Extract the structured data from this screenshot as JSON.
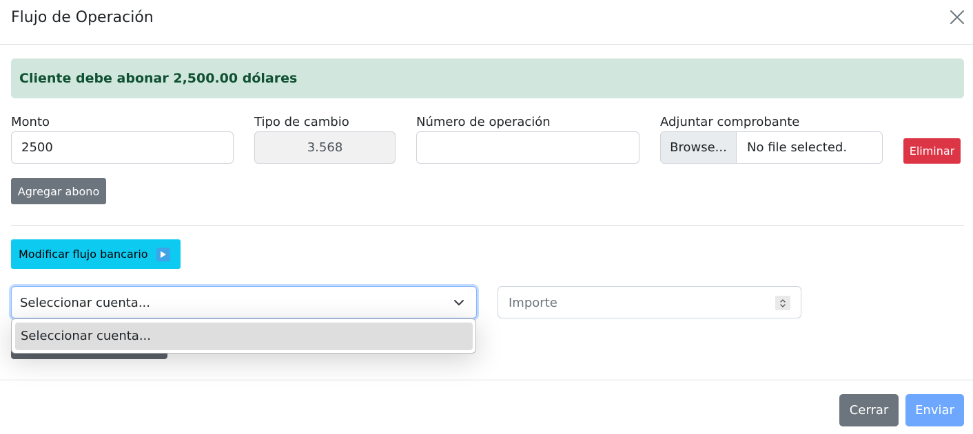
{
  "modal": {
    "title": "Flujo de Operación"
  },
  "alert": {
    "text": "Cliente debe abonar 2,500.00 dólares"
  },
  "fields": {
    "monto": {
      "label": "Monto",
      "value": "2500"
    },
    "tipo_cambio": {
      "label": "Tipo de cambio",
      "value": "3.568"
    },
    "numero_operacion": {
      "label": "Número de operación",
      "value": ""
    },
    "adjuntar": {
      "label": "Adjuntar comprobante",
      "browse_label": "Browse...",
      "file_status": "No file selected."
    }
  },
  "buttons": {
    "eliminar": "Eliminar",
    "agregar_abono": "Agregar abono",
    "modificar_flujo": "Modificar flujo bancario",
    "cerrar": "Cerrar",
    "enviar": "Enviar"
  },
  "bank_flow": {
    "account_select": {
      "selected": "Seleccionar cuenta...",
      "options": [
        "Seleccionar cuenta..."
      ]
    },
    "importe": {
      "placeholder": "Importe",
      "value": ""
    }
  },
  "colors": {
    "alert_bg": "#d1e7dd",
    "alert_text": "#0f5132",
    "danger": "#dc3545",
    "secondary": "#6c757d",
    "info": "#0dcaf0",
    "primary_disabled": "#6ea8fe"
  },
  "icons": {
    "close": "close-icon",
    "play": "play-icon",
    "chevron": "chevron-down-icon",
    "spinner": "spinner-icon"
  }
}
